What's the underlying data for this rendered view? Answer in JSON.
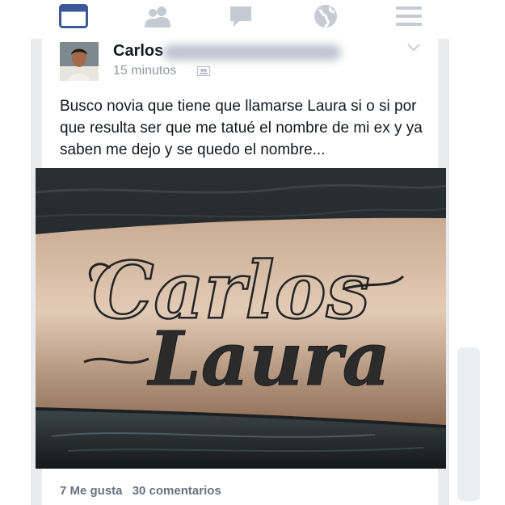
{
  "nav": [
    {
      "icon": "news-feed-icon",
      "active": true
    },
    {
      "icon": "friends-icon",
      "active": false
    },
    {
      "icon": "messages-icon",
      "active": false
    },
    {
      "icon": "notifications-globe-icon",
      "active": false
    },
    {
      "icon": "menu-icon",
      "active": false
    }
  ],
  "post": {
    "author": "Carlos",
    "timestamp": "15 minutos",
    "text": "Busco novia que tiene que llamarse Laura si o si por que resulta ser que me tatué el nombre de mi ex y ya saben me dejo y se quedo el nombre...",
    "photo": {
      "tattoo_line1": "Carlos",
      "tattoo_line2": "Laura"
    },
    "likes": "7 Me gusta",
    "comments": "30 comentarios"
  },
  "colors": {
    "brand": "#3b5998",
    "inactive_icon": "#c5cad3",
    "text": "#141823",
    "meta": "#9197a3"
  }
}
